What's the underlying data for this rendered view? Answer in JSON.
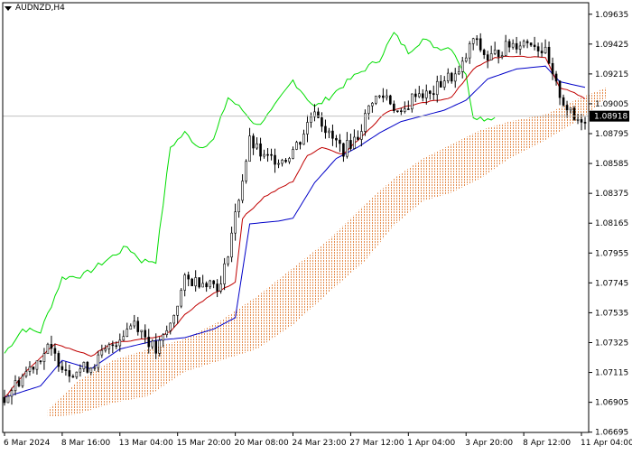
{
  "symbol_label": "AUDNZD,H4",
  "current_price_label": "1.08918",
  "colors": {
    "background": "#ffffff",
    "frame": "#000000",
    "candle_up": "#000000",
    "candle_down": "#000000",
    "tenkan": "#c00000",
    "kijun": "#0000c8",
    "chikou": "#00dd00",
    "cloud": "#e07a30",
    "current_price_line": "#c0c0c0",
    "current_price_box": "#000000",
    "current_price_text": "#ffffff"
  },
  "chart_data": {
    "type": "candlestick",
    "symbol": "AUDNZD",
    "timeframe": "H4",
    "ylim": [
      1.06693,
      1.09716
    ],
    "y_ticks": [
      "1.09635",
      "1.09425",
      "1.09215",
      "1.09005",
      "1.08795",
      "1.08585",
      "1.08375",
      "1.08165",
      "1.07955",
      "1.07745",
      "1.07535",
      "1.07325",
      "1.07115",
      "1.06905",
      "1.06695"
    ],
    "x_ticks": [
      "6 Mar 2024",
      "8 Mar 16:00",
      "13 Mar 04:00",
      "15 Mar 20:00",
      "20 Mar 08:00",
      "24 Mar 23:00",
      "27 Mar 12:00",
      "1 Apr 04:00",
      "3 Apr 20:00",
      "8 Apr 12:00",
      "11 Apr 04:00"
    ],
    "x_tick_bar_index": [
      0,
      16,
      32,
      48,
      64,
      80,
      96,
      112,
      128,
      144,
      160
    ],
    "current_price": 1.08918,
    "bars_visible": 162,
    "cloud_extends_bars": 6,
    "ohlc_anchors": [
      [
        0,
        1.0694
      ],
      [
        6,
        1.0712
      ],
      [
        12,
        1.0728
      ],
      [
        18,
        1.0712
      ],
      [
        24,
        1.0716
      ],
      [
        30,
        1.0731
      ],
      [
        36,
        1.0748
      ],
      [
        42,
        1.0726
      ],
      [
        46,
        1.0745
      ],
      [
        50,
        1.0776
      ],
      [
        56,
        1.0776
      ],
      [
        60,
        1.0772
      ],
      [
        64,
        1.0822
      ],
      [
        68,
        1.0874
      ],
      [
        72,
        1.0862
      ],
      [
        78,
        1.0862
      ],
      [
        82,
        1.0875
      ],
      [
        86,
        1.0898
      ],
      [
        90,
        1.0878
      ],
      [
        94,
        1.0868
      ],
      [
        98,
        1.0878
      ],
      [
        102,
        1.0904
      ],
      [
        106,
        1.0906
      ],
      [
        110,
        1.0891
      ],
      [
        114,
        1.0909
      ],
      [
        118,
        1.0906
      ],
      [
        122,
        1.0918
      ],
      [
        126,
        1.0921
      ],
      [
        130,
        1.0946
      ],
      [
        134,
        1.0932
      ],
      [
        140,
        1.0942
      ],
      [
        146,
        1.0945
      ],
      [
        150,
        1.0936
      ],
      [
        152,
        1.0918
      ],
      [
        155,
        1.0902
      ],
      [
        158,
        1.0889
      ],
      [
        161,
        1.0891
      ]
    ],
    "tenkan_anchors": [
      [
        0,
        1.0694
      ],
      [
        6,
        1.0712
      ],
      [
        14,
        1.0732
      ],
      [
        24,
        1.0723
      ],
      [
        30,
        1.0732
      ],
      [
        42,
        1.0736
      ],
      [
        46,
        1.074
      ],
      [
        50,
        1.0752
      ],
      [
        56,
        1.0764
      ],
      [
        64,
        1.0775
      ],
      [
        66,
        1.082
      ],
      [
        72,
        1.0835
      ],
      [
        80,
        1.0846
      ],
      [
        84,
        1.0864
      ],
      [
        88,
        1.087
      ],
      [
        94,
        1.0865
      ],
      [
        100,
        1.088
      ],
      [
        106,
        1.0895
      ],
      [
        112,
        1.0899
      ],
      [
        118,
        1.0902
      ],
      [
        124,
        1.0905
      ],
      [
        130,
        1.0925
      ],
      [
        136,
        1.0933
      ],
      [
        142,
        1.0934
      ],
      [
        150,
        1.0933
      ],
      [
        154,
        1.0912
      ],
      [
        158,
        1.0908
      ],
      [
        161,
        1.0904
      ]
    ],
    "kijun_anchors": [
      [
        0,
        1.0694
      ],
      [
        10,
        1.0702
      ],
      [
        16,
        1.072
      ],
      [
        24,
        1.0714
      ],
      [
        32,
        1.0728
      ],
      [
        42,
        1.0734
      ],
      [
        50,
        1.0736
      ],
      [
        58,
        1.0742
      ],
      [
        64,
        1.075
      ],
      [
        68,
        1.0816
      ],
      [
        76,
        1.0818
      ],
      [
        80,
        1.082
      ],
      [
        86,
        1.0845
      ],
      [
        92,
        1.0862
      ],
      [
        98,
        1.087
      ],
      [
        104,
        1.088
      ],
      [
        110,
        1.0888
      ],
      [
        116,
        1.0892
      ],
      [
        122,
        1.0896
      ],
      [
        128,
        1.0903
      ],
      [
        134,
        1.0918
      ],
      [
        142,
        1.0925
      ],
      [
        150,
        1.0927
      ],
      [
        154,
        1.0916
      ],
      [
        161,
        1.0912
      ]
    ],
    "chikou_anchors": [
      [
        0,
        1.0725
      ],
      [
        5,
        1.0742
      ],
      [
        10,
        1.074
      ],
      [
        16,
        1.0778
      ],
      [
        22,
        1.078
      ],
      [
        28,
        1.079
      ],
      [
        34,
        1.08
      ],
      [
        38,
        1.079
      ],
      [
        42,
        1.079
      ],
      [
        46,
        1.087
      ],
      [
        50,
        1.088
      ],
      [
        54,
        1.087
      ],
      [
        58,
        1.0875
      ],
      [
        62,
        1.0905
      ],
      [
        66,
        1.0896
      ],
      [
        70,
        1.0885
      ],
      [
        74,
        1.0895
      ],
      [
        80,
        1.0917
      ],
      [
        86,
        1.0898
      ],
      [
        90,
        1.0905
      ],
      [
        96,
        1.0918
      ],
      [
        100,
        1.0925
      ],
      [
        104,
        1.0932
      ],
      [
        108,
        1.095
      ],
      [
        112,
        1.0937
      ],
      [
        116,
        1.0946
      ],
      [
        120,
        1.094
      ],
      [
        124,
        1.094
      ],
      [
        128,
        1.092
      ],
      [
        130,
        1.0892
      ],
      [
        133,
        1.089
      ],
      [
        136,
        1.0891
      ]
    ],
    "span_a_anchors": [
      [
        12,
        1.0685
      ],
      [
        20,
        1.0705
      ],
      [
        30,
        1.072
      ],
      [
        40,
        1.0728
      ],
      [
        50,
        1.0735
      ],
      [
        60,
        1.0748
      ],
      [
        70,
        1.0765
      ],
      [
        80,
        1.0785
      ],
      [
        90,
        1.0805
      ],
      [
        100,
        1.083
      ],
      [
        108,
        1.0848
      ],
      [
        116,
        1.0862
      ],
      [
        124,
        1.0872
      ],
      [
        132,
        1.0882
      ],
      [
        140,
        1.0888
      ],
      [
        150,
        1.0893
      ],
      [
        160,
        1.0905
      ],
      [
        167,
        1.0912
      ]
    ],
    "span_b_anchors": [
      [
        12,
        1.068
      ],
      [
        20,
        1.0682
      ],
      [
        30,
        1.069
      ],
      [
        40,
        1.0695
      ],
      [
        50,
        1.0712
      ],
      [
        60,
        1.072
      ],
      [
        70,
        1.0728
      ],
      [
        80,
        1.0745
      ],
      [
        90,
        1.0768
      ],
      [
        100,
        1.079
      ],
      [
        108,
        1.0815
      ],
      [
        116,
        1.0832
      ],
      [
        124,
        1.0838
      ],
      [
        132,
        1.0848
      ],
      [
        140,
        1.0862
      ],
      [
        150,
        1.0875
      ],
      [
        160,
        1.089
      ],
      [
        167,
        1.0905
      ]
    ]
  }
}
